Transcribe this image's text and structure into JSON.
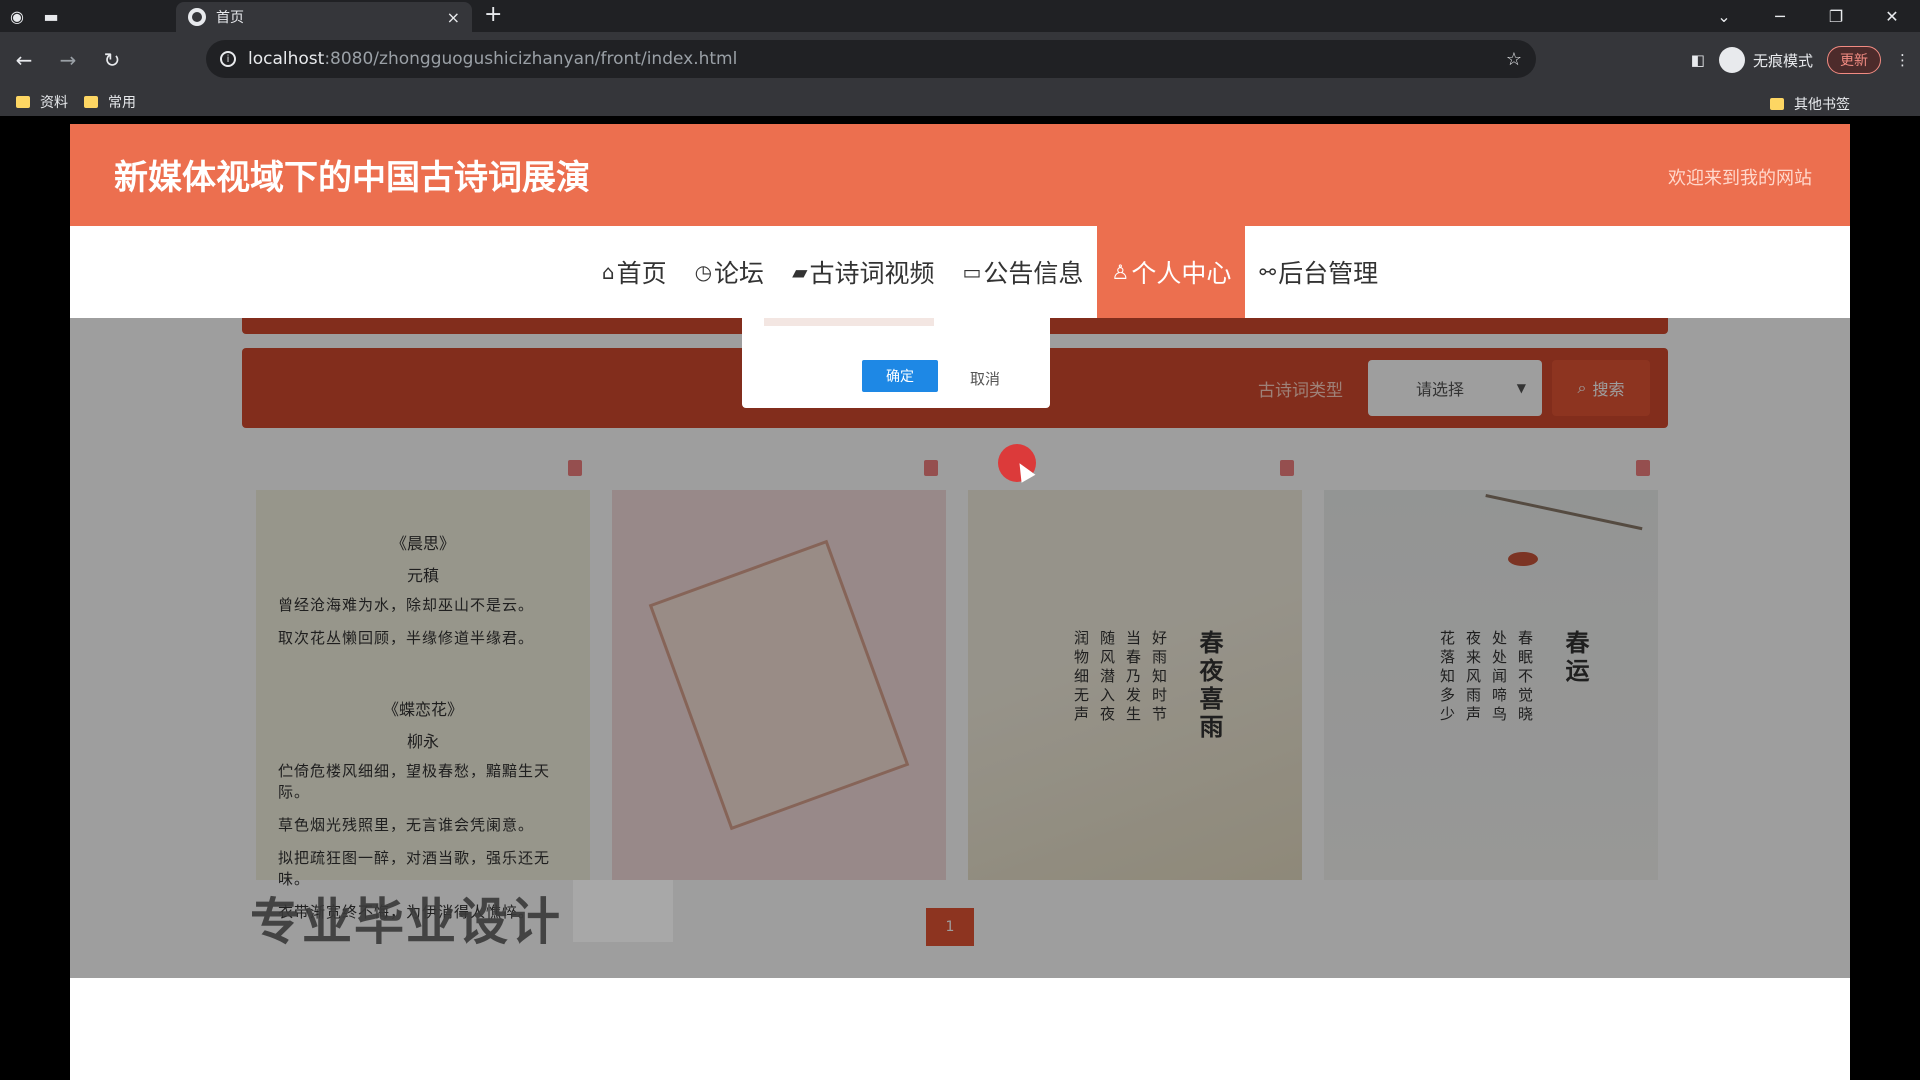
{
  "browser": {
    "tab_title": "首页",
    "close_tab": "×",
    "new_tab": "+",
    "url_host": "localhost",
    "url_path": ":8080/zhongguogushicizhanyan/front/index.html",
    "incognito_label": "无痕模式",
    "update_label": "更新",
    "bookmarks": [
      "资料",
      "常用"
    ],
    "other_bookmarks": "其他书签"
  },
  "site": {
    "title": "新媒体视域下的中国古诗词展演",
    "welcome": "欢迎来到我的网站",
    "nav": [
      {
        "label": "首页",
        "icon": "home-icon"
      },
      {
        "label": "论坛",
        "icon": "clock-icon"
      },
      {
        "label": "古诗词视频",
        "icon": "graduation-cap-icon"
      },
      {
        "label": "公告信息",
        "icon": "book-icon"
      },
      {
        "label": "个人中心",
        "icon": "user-icon",
        "active": true
      },
      {
        "label": "后台管理",
        "icon": "link-icon"
      }
    ]
  },
  "search": {
    "label": "古诗词类型",
    "select_value": "请选择",
    "button": "搜索"
  },
  "cards": {
    "poem1": {
      "title1": "《晨思》",
      "author1": "元稹",
      "line1": "曾经沧海难为水，除却巫山不是云。",
      "line2": "取次花丛懒回顾，半缘修道半缘君。",
      "title2": "《蝶恋花》",
      "author2": "柳永",
      "line3": "伫倚危楼风细细，望极春愁，黯黯生天际。",
      "line4": "草色烟光残照里，无言谁会凭阑意。",
      "line5": "拟把疏狂图一醉，对酒当歌，强乐还无味。",
      "line6": "衣带渐宽终不悔，为伊消得人憔悴。"
    },
    "poem3": {
      "title": "春夜喜雨",
      "text": "好雨知时节当春乃发生随风潜入夜润物细无声"
    },
    "poem4": {
      "title": "春运",
      "text": "春眠不觉晓处处闻啼鸟夜来风雨声花落知多少"
    }
  },
  "pager": {
    "current": "1"
  },
  "dialog": {
    "ok": "确定",
    "cancel": "取消"
  },
  "watermark": "专业毕业设计"
}
